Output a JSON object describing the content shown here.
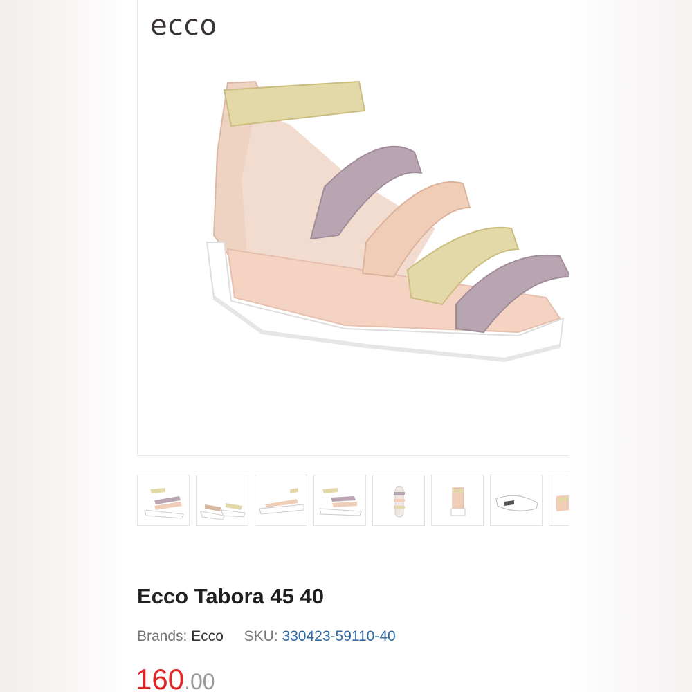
{
  "brand_logo": "ecco",
  "product": {
    "title": "Ecco Tabora 45 40",
    "brands_label": "Brands:",
    "brand": "Ecco",
    "sku_label": "SKU:",
    "sku": "330423-59110-40",
    "price_whole": "160",
    "price_decimal": ".00"
  },
  "thumbnails": [
    {
      "icon": "sandal-front-view"
    },
    {
      "icon": "sandal-pair-view"
    },
    {
      "icon": "sandal-side-view"
    },
    {
      "icon": "sandal-three-quarter-view"
    },
    {
      "icon": "sandal-top-view"
    },
    {
      "icon": "sandal-back-view"
    },
    {
      "icon": "sandal-sole-view"
    },
    {
      "icon": "sandal-partial-view"
    }
  ],
  "colors": {
    "price": "#e02626",
    "sku_link": "#2d6aa6",
    "strap_gold": "#e3d9a8",
    "strap_lilac": "#b9a5b1",
    "strap_nude": "#efcdb7",
    "sole": "#ffffff"
  }
}
